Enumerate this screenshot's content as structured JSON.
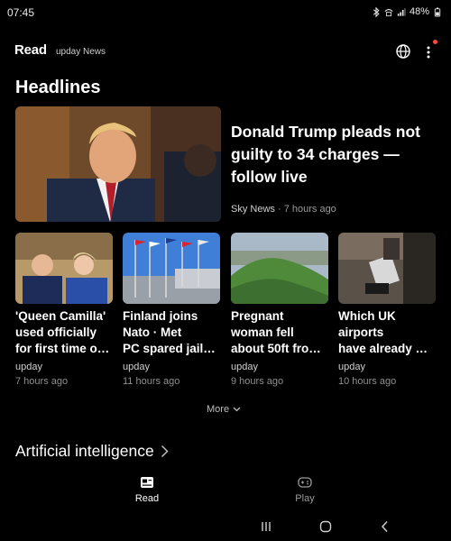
{
  "status_bar": {
    "time": "07:45",
    "battery": "48%"
  },
  "app_bar": {
    "brand": "Read",
    "brand_sub": "upday News"
  },
  "section": {
    "headlines": "Headlines"
  },
  "hero": {
    "title": "Donald Trump pleads not guilty to 34 charges — follow live",
    "source": "Sky News",
    "separator": "·",
    "time": "7 hours ago"
  },
  "cards": [
    {
      "title": "'Queen Camilla'\nused officially\nfor first time o…",
      "source": "upday",
      "time": "7 hours ago"
    },
    {
      "title": "Finland joins\nNato · Met\nPC spared jail…",
      "source": "upday",
      "time": "11 hours ago"
    },
    {
      "title": "Pregnant\nwoman fell\nabout 50ft fro…",
      "source": "upday",
      "time": "9 hours ago"
    },
    {
      "title": "Which UK\nairports\nhave already …",
      "source": "upday",
      "time": "10 hours ago"
    }
  ],
  "more": {
    "label": "More"
  },
  "ai_section": {
    "label": "Artificial intelligence"
  },
  "bottom_nav": [
    {
      "label": "Read",
      "icon": "newspaper-icon",
      "selected": true
    },
    {
      "label": "Play",
      "icon": "gamepad-icon",
      "selected": false
    }
  ],
  "colors": {
    "background": "#000000",
    "text": "#ffffff",
    "muted": "#9a9a9a",
    "notification": "#ff4a3d"
  }
}
